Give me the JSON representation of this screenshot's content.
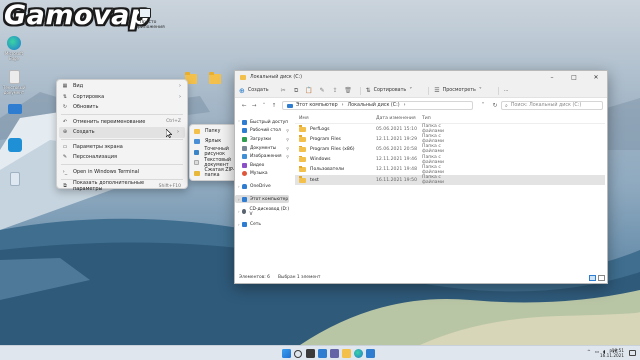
{
  "logo": {
    "text": "Gamovap",
    "subtitle": "Просто приложения"
  },
  "desktop_icons": [
    {
      "name": "Microsoft Edge",
      "color": "#1f7ad1"
    },
    {
      "name": "Текстовый документ",
      "color": "#e8e8e8"
    },
    {
      "name": "",
      "color": "#2f7dd1"
    },
    {
      "name": "",
      "color": "#1f8fd6"
    }
  ],
  "context_menu": {
    "items": [
      {
        "label": "Вид",
        "icon": "grid-icon",
        "arrow": "›"
      },
      {
        "label": "Сортировка",
        "icon": "sort-icon",
        "arrow": "›"
      },
      {
        "label": "Обновить",
        "icon": "refresh-icon"
      },
      {
        "label": "Отменить переименование",
        "icon": "undo-icon",
        "shortcut": "Ctrl+Z"
      },
      {
        "label": "Создать",
        "icon": "new-icon",
        "arrow": "›"
      },
      {
        "label": "Параметры экрана",
        "icon": "display-icon"
      },
      {
        "label": "Персонализация",
        "icon": "brush-icon"
      },
      {
        "label": "Open in Windows Terminal",
        "icon": "terminal-icon"
      },
      {
        "label": "Показать дополнительные параметры",
        "icon": "more-icon",
        "shortcut": "Shift+F10"
      }
    ]
  },
  "submenu": {
    "items": [
      {
        "label": "Папку",
        "color": "#f3c14b"
      },
      {
        "label": "Ярлык",
        "color": "#4a8fd6"
      },
      {
        "label": "Точечный рисунок",
        "color": "#3a84c7"
      },
      {
        "label": "Текстовый документ",
        "color": "#dcdcdc"
      },
      {
        "label": "Сжатая ZIP-папка",
        "color": "#e8b83a"
      }
    ]
  },
  "explorer": {
    "title": "Локальный диск (C:)",
    "window_controls": [
      "–",
      "□",
      "✕"
    ],
    "toolbar": {
      "new_label": "Создать",
      "sort_label": "Сортировать",
      "view_label": "Просмотреть",
      "more_label": "..."
    },
    "address": {
      "segments": [
        "Этот компьютер",
        "›",
        "Локальный диск (C:)",
        "›"
      ]
    },
    "search_placeholder": "Поиск: Локальный диск (C:)",
    "nav_pane": [
      {
        "label": "Быстрый доступ",
        "icon_color": "#2f7dd1",
        "chevron": "˅",
        "pin": ""
      },
      {
        "label": "Рабочий стол",
        "icon_color": "#2f7dd1",
        "pin": "📌"
      },
      {
        "label": "Загрузки",
        "icon_color": "#2f9d4e",
        "pin": "📌"
      },
      {
        "label": "Документы",
        "icon_color": "#7a8896",
        "pin": "📌"
      },
      {
        "label": "Изображения",
        "icon_color": "#3f8fd6",
        "pin": "📌"
      },
      {
        "label": "Видео",
        "icon_color": "#8b4fc7"
      },
      {
        "label": "Музыка",
        "icon_color": "#e0563a"
      },
      {
        "label": "OneDrive",
        "icon_color": "#2f7dd1",
        "chevron": "›"
      },
      {
        "label": "Этот компьютер",
        "icon_color": "#2f7dd1",
        "chevron": "›"
      },
      {
        "label": "CD-дисковод (D:) V",
        "icon_color": "#5a6470",
        "chevron": "›"
      },
      {
        "label": "Сеть",
        "icon_color": "#2f7dd1",
        "chevron": "›"
      }
    ],
    "columns": {
      "name": "Имя",
      "date": "Дата изменения",
      "type": "Тип"
    },
    "files": [
      {
        "name": "PerfLogs",
        "date": "05.06.2021 15:10",
        "type": "Папка с файлами"
      },
      {
        "name": "Program Files",
        "date": "12.11.2021 19:29",
        "type": "Папка с файлами"
      },
      {
        "name": "Program Files (x86)",
        "date": "05.06.2021 20:58",
        "type": "Папка с файлами"
      },
      {
        "name": "Windows",
        "date": "12.11.2021 19:46",
        "type": "Папка с файлами"
      },
      {
        "name": "Пользователи",
        "date": "12.11.2021 19:48",
        "type": "Папка с файлами"
      },
      {
        "name": "test",
        "date": "16.11.2021 19:50",
        "type": "Папка с файлами"
      }
    ],
    "status": {
      "count": "Элементов: 6",
      "selected": "Выбран 1 элемент"
    }
  },
  "taskbar": {
    "apps": [
      {
        "name": "start-icon",
        "color": "#2f7dd1"
      },
      {
        "name": "search-icon",
        "color": "#3a3a3a"
      },
      {
        "name": "task-view-icon",
        "color": "#3a3a3a"
      },
      {
        "name": "widgets-icon",
        "color": "#2f7dd1"
      },
      {
        "name": "chat-icon",
        "color": "#6264a7"
      },
      {
        "name": "explorer-icon",
        "color": "#f3c14b"
      },
      {
        "name": "edge-icon",
        "color": "#1fa37a"
      },
      {
        "name": "store-icon",
        "color": "#2f7dd1"
      }
    ],
    "tray": {
      "chevron": "^",
      "lang": "РУС"
    },
    "time": "19:51",
    "date": "16.11.2021"
  }
}
